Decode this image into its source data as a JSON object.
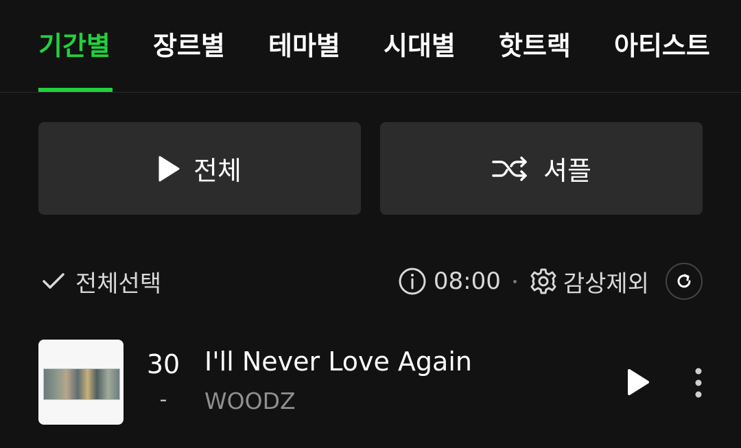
{
  "tabs": [
    {
      "label": "기간별",
      "active": true
    },
    {
      "label": "장르별",
      "active": false
    },
    {
      "label": "테마별",
      "active": false
    },
    {
      "label": "시대별",
      "active": false
    },
    {
      "label": "핫트랙",
      "active": false
    },
    {
      "label": "아티스트",
      "active": false
    }
  ],
  "actions": {
    "play_all_label": "전체",
    "shuffle_label": "셔플"
  },
  "controls": {
    "select_all_label": "전체선택",
    "time": "08:00",
    "exclude_label": "감상제외"
  },
  "tracks": [
    {
      "rank": "30",
      "rank_change": "-",
      "title": "I'll Never Love Again",
      "artist": "WOODZ"
    }
  ],
  "colors": {
    "accent": "#22d13d",
    "background": "#121212",
    "button_bg": "#2c2c2c"
  },
  "icons": {
    "play": "play-icon",
    "shuffle": "shuffle-icon",
    "check": "check-icon",
    "info": "info-icon",
    "settings": "gear-icon",
    "refresh": "refresh-icon",
    "more": "more-vertical-icon"
  }
}
